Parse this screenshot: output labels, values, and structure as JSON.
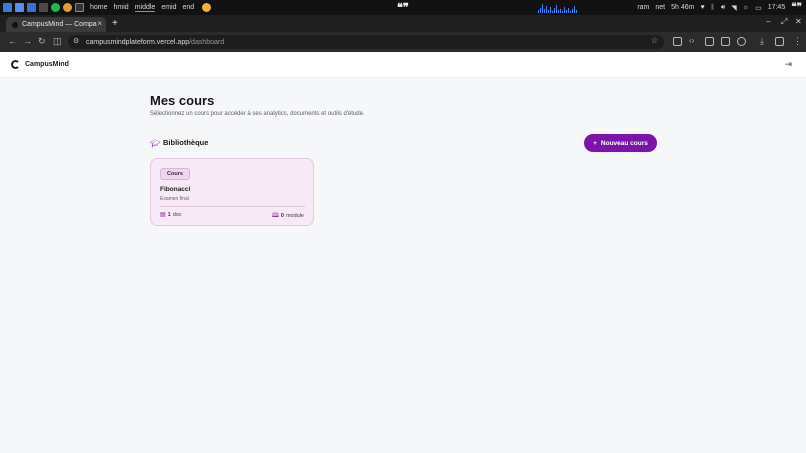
{
  "taskbar": {
    "workspaces": [
      "home",
      "hmid",
      "middle",
      "emid",
      "end"
    ],
    "active_workspace": "middle",
    "quote": "❝❞",
    "status": [
      "ram",
      "net",
      "5h 46m"
    ],
    "time": "17:45",
    "right_quote": "❝❞"
  },
  "browser": {
    "tab_title": "CampusMind — Compa",
    "tab_close": "×",
    "new_tab": "+",
    "url_host": "campusmindplateform.vercel.app",
    "url_path": "/dashboard",
    "window_controls": [
      "–",
      "⤢",
      "✕"
    ]
  },
  "app": {
    "brand": "CampusMind",
    "title": "Mes cours",
    "subtitle": "Sélectionnez un cours pour accéder à ses analytics, documents et outils d'étude.",
    "library_title": "Bibliothèque",
    "new_course_button": "Nouveau cours",
    "new_course_plus": "+"
  },
  "courses": [
    {
      "badge": "Cours",
      "title": "Fibonacci",
      "subtitle": "Examen final",
      "docs_count": "1",
      "docs_label": "doc",
      "modules_count": "0",
      "modules_label": "module"
    }
  ],
  "colors": {
    "accent": "#7b14a8",
    "card_bg": "#f8e9f7",
    "page_bg": "#f6f7f9"
  }
}
